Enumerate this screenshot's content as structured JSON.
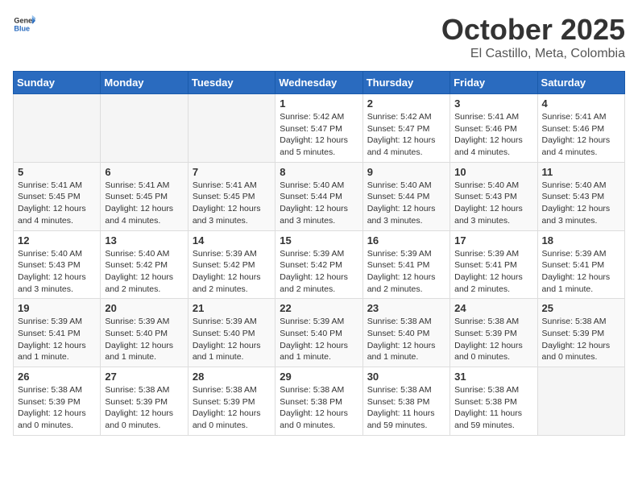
{
  "header": {
    "logo_general": "General",
    "logo_blue": "Blue",
    "month_year": "October 2025",
    "location": "El Castillo, Meta, Colombia"
  },
  "weekdays": [
    "Sunday",
    "Monday",
    "Tuesday",
    "Wednesday",
    "Thursday",
    "Friday",
    "Saturday"
  ],
  "weeks": [
    [
      {
        "day": "",
        "info": ""
      },
      {
        "day": "",
        "info": ""
      },
      {
        "day": "",
        "info": ""
      },
      {
        "day": "1",
        "info": "Sunrise: 5:42 AM\nSunset: 5:47 PM\nDaylight: 12 hours\nand 5 minutes."
      },
      {
        "day": "2",
        "info": "Sunrise: 5:42 AM\nSunset: 5:47 PM\nDaylight: 12 hours\nand 4 minutes."
      },
      {
        "day": "3",
        "info": "Sunrise: 5:41 AM\nSunset: 5:46 PM\nDaylight: 12 hours\nand 4 minutes."
      },
      {
        "day": "4",
        "info": "Sunrise: 5:41 AM\nSunset: 5:46 PM\nDaylight: 12 hours\nand 4 minutes."
      }
    ],
    [
      {
        "day": "5",
        "info": "Sunrise: 5:41 AM\nSunset: 5:45 PM\nDaylight: 12 hours\nand 4 minutes."
      },
      {
        "day": "6",
        "info": "Sunrise: 5:41 AM\nSunset: 5:45 PM\nDaylight: 12 hours\nand 4 minutes."
      },
      {
        "day": "7",
        "info": "Sunrise: 5:41 AM\nSunset: 5:45 PM\nDaylight: 12 hours\nand 3 minutes."
      },
      {
        "day": "8",
        "info": "Sunrise: 5:40 AM\nSunset: 5:44 PM\nDaylight: 12 hours\nand 3 minutes."
      },
      {
        "day": "9",
        "info": "Sunrise: 5:40 AM\nSunset: 5:44 PM\nDaylight: 12 hours\nand 3 minutes."
      },
      {
        "day": "10",
        "info": "Sunrise: 5:40 AM\nSunset: 5:43 PM\nDaylight: 12 hours\nand 3 minutes."
      },
      {
        "day": "11",
        "info": "Sunrise: 5:40 AM\nSunset: 5:43 PM\nDaylight: 12 hours\nand 3 minutes."
      }
    ],
    [
      {
        "day": "12",
        "info": "Sunrise: 5:40 AM\nSunset: 5:43 PM\nDaylight: 12 hours\nand 3 minutes."
      },
      {
        "day": "13",
        "info": "Sunrise: 5:40 AM\nSunset: 5:42 PM\nDaylight: 12 hours\nand 2 minutes."
      },
      {
        "day": "14",
        "info": "Sunrise: 5:39 AM\nSunset: 5:42 PM\nDaylight: 12 hours\nand 2 minutes."
      },
      {
        "day": "15",
        "info": "Sunrise: 5:39 AM\nSunset: 5:42 PM\nDaylight: 12 hours\nand 2 minutes."
      },
      {
        "day": "16",
        "info": "Sunrise: 5:39 AM\nSunset: 5:41 PM\nDaylight: 12 hours\nand 2 minutes."
      },
      {
        "day": "17",
        "info": "Sunrise: 5:39 AM\nSunset: 5:41 PM\nDaylight: 12 hours\nand 2 minutes."
      },
      {
        "day": "18",
        "info": "Sunrise: 5:39 AM\nSunset: 5:41 PM\nDaylight: 12 hours\nand 1 minute."
      }
    ],
    [
      {
        "day": "19",
        "info": "Sunrise: 5:39 AM\nSunset: 5:41 PM\nDaylight: 12 hours\nand 1 minute."
      },
      {
        "day": "20",
        "info": "Sunrise: 5:39 AM\nSunset: 5:40 PM\nDaylight: 12 hours\nand 1 minute."
      },
      {
        "day": "21",
        "info": "Sunrise: 5:39 AM\nSunset: 5:40 PM\nDaylight: 12 hours\nand 1 minute."
      },
      {
        "day": "22",
        "info": "Sunrise: 5:39 AM\nSunset: 5:40 PM\nDaylight: 12 hours\nand 1 minute."
      },
      {
        "day": "23",
        "info": "Sunrise: 5:38 AM\nSunset: 5:40 PM\nDaylight: 12 hours\nand 1 minute."
      },
      {
        "day": "24",
        "info": "Sunrise: 5:38 AM\nSunset: 5:39 PM\nDaylight: 12 hours\nand 0 minutes."
      },
      {
        "day": "25",
        "info": "Sunrise: 5:38 AM\nSunset: 5:39 PM\nDaylight: 12 hours\nand 0 minutes."
      }
    ],
    [
      {
        "day": "26",
        "info": "Sunrise: 5:38 AM\nSunset: 5:39 PM\nDaylight: 12 hours\nand 0 minutes."
      },
      {
        "day": "27",
        "info": "Sunrise: 5:38 AM\nSunset: 5:39 PM\nDaylight: 12 hours\nand 0 minutes."
      },
      {
        "day": "28",
        "info": "Sunrise: 5:38 AM\nSunset: 5:39 PM\nDaylight: 12 hours\nand 0 minutes."
      },
      {
        "day": "29",
        "info": "Sunrise: 5:38 AM\nSunset: 5:38 PM\nDaylight: 12 hours\nand 0 minutes."
      },
      {
        "day": "30",
        "info": "Sunrise: 5:38 AM\nSunset: 5:38 PM\nDaylight: 11 hours\nand 59 minutes."
      },
      {
        "day": "31",
        "info": "Sunrise: 5:38 AM\nSunset: 5:38 PM\nDaylight: 11 hours\nand 59 minutes."
      },
      {
        "day": "",
        "info": ""
      }
    ]
  ]
}
